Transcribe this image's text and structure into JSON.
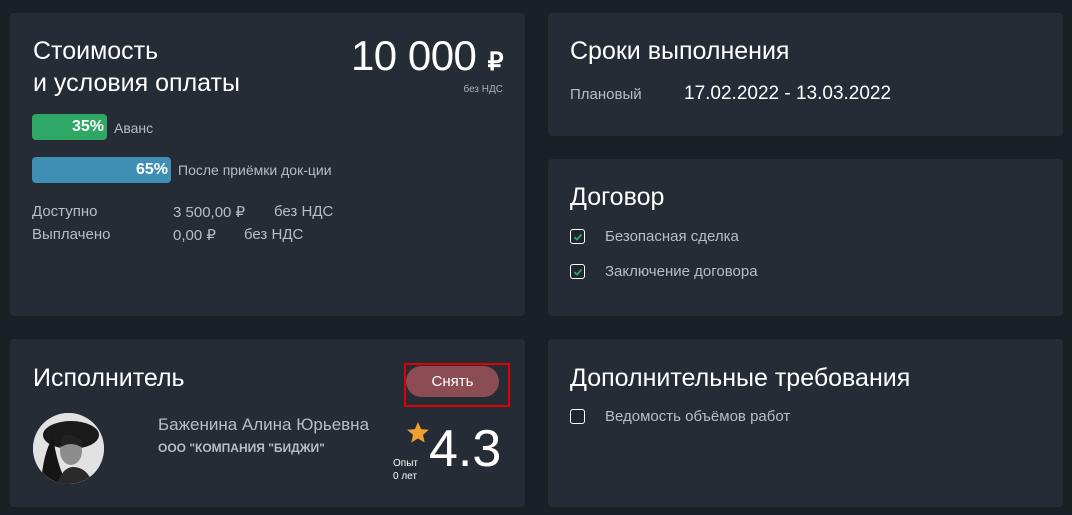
{
  "cost": {
    "title_line1": "Стоимость",
    "title_line2": "и условия оплаты",
    "price": "10 000",
    "currency": "₽",
    "vat_note": "без НДС",
    "payments": [
      {
        "percent": "35%",
        "fraction": 0.35,
        "label": "Аванс",
        "color": "#2fa765"
      },
      {
        "percent": "65%",
        "fraction": 0.65,
        "label": "После приёмки док-ции",
        "color": "#3e8fb3"
      }
    ],
    "available_label": "Доступно",
    "available_value": "3 500,00 ₽",
    "available_vat": "без НДС",
    "paid_label": "Выплачено",
    "paid_value": "0,00 ₽",
    "paid_vat": "без НДС"
  },
  "deadlines": {
    "title": "Сроки выполнения",
    "planned_label": "Плановый",
    "planned_value": "17.02.2022 - 13.03.2022"
  },
  "contract": {
    "title": "Договор",
    "items": [
      {
        "label": "Безопасная сделка",
        "checked": true
      },
      {
        "label": "Заключение договора",
        "checked": true
      }
    ]
  },
  "executor": {
    "title": "Исполнитель",
    "remove_button": "Снять",
    "name": "Баженина Алина Юрьевна",
    "company": "ООО \"КОМПАНИЯ \"БИДЖИ\"",
    "rating": "4.3",
    "experience_label": "Опыт",
    "experience_value": "0 лет",
    "star_icon": "star-icon",
    "star_color": "#f0a030"
  },
  "extra": {
    "title": "Дополнительные требования",
    "items": [
      {
        "label": "Ведомость объёмов работ",
        "checked": false
      }
    ]
  }
}
